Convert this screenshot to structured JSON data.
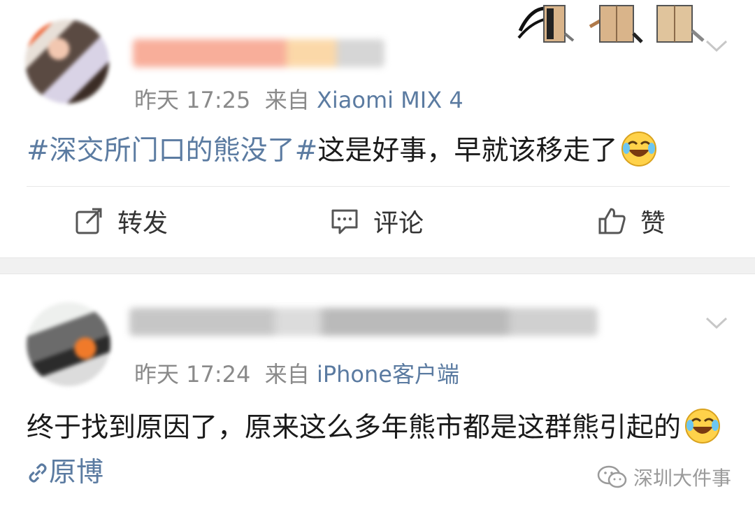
{
  "posts": [
    {
      "time": "昨天 17:25",
      "source_prefix": "来自",
      "source": "Xiaomi MIX 4",
      "hashtag": "#深交所门口的熊没了#",
      "text": "这是好事，早就该移走了",
      "actions": {
        "repost": "转发",
        "comment": "评论",
        "like": "赞"
      }
    },
    {
      "time": "昨天 17:24",
      "source_prefix": "来自",
      "source": "iPhone客户端",
      "text": "终于找到原因了，原来这么多年熊市都是这群熊引起的",
      "link": "原博"
    }
  ],
  "watermark": "深圳大件事",
  "colors": {
    "link": "#5b7ba1",
    "meta": "#8a8a8a",
    "divider": "#f1f1f1"
  },
  "icons": [
    "repost-icon",
    "comment-icon",
    "like-icon",
    "laugh-cry-emoji",
    "link-icon",
    "wechat-icon",
    "chevron-down-icon"
  ]
}
